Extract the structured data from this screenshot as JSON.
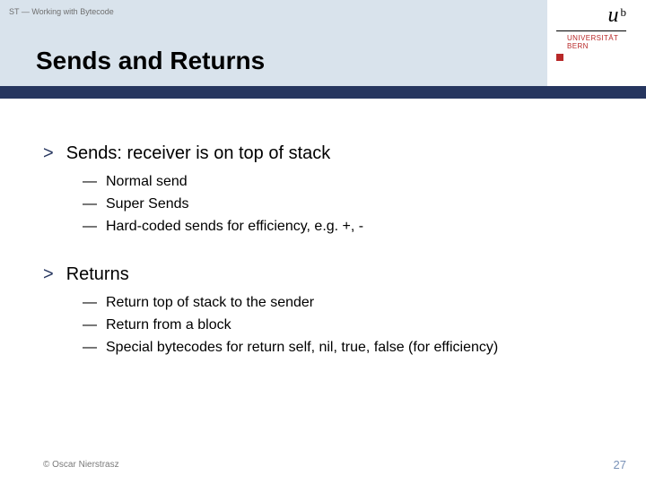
{
  "header": {
    "breadcrumb": "ST — Working with Bytecode",
    "title": "Sends and Returns"
  },
  "logo": {
    "u": "u",
    "b": "b",
    "line1": "UNIVERSITÄT",
    "line2": "BERN"
  },
  "bullets": [
    {
      "text": "Sends: receiver is on top of stack",
      "sub": [
        "Normal send",
        "Super Sends",
        "Hard-coded sends for efficiency, e.g. +, -"
      ]
    },
    {
      "text": "Returns",
      "sub": [
        "Return top of stack to the sender",
        "Return from a block",
        "Special bytecodes for return self, nil, true, false (for efficiency)"
      ]
    }
  ],
  "footer": {
    "copyright": "© Oscar Nierstrasz",
    "page": "27"
  },
  "glyph": {
    "gt": ">",
    "dash": "—"
  }
}
